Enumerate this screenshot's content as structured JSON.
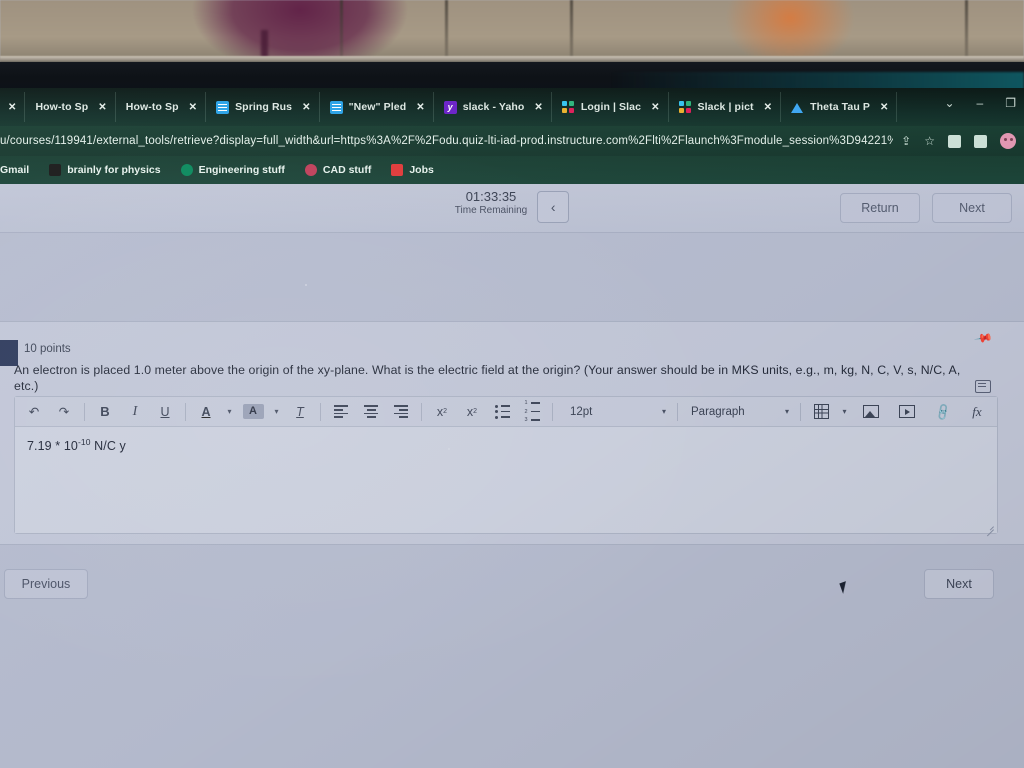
{
  "browser": {
    "tabs": [
      {
        "title": "",
        "favicon": "none",
        "close_label": "✕"
      },
      {
        "title": "How-to Sp",
        "favicon": "none",
        "close_label": "✕"
      },
      {
        "title": "How-to Sp",
        "favicon": "none",
        "close_label": "✕"
      },
      {
        "title": "Spring Rus",
        "favicon": "doc-icon",
        "close_label": "✕"
      },
      {
        "title": "\"New\" Pled",
        "favicon": "doc-icon",
        "close_label": "✕"
      },
      {
        "title": "slack - Yaho",
        "favicon": "yahoo-icon",
        "close_label": "✕"
      },
      {
        "title": "Login | Slac",
        "favicon": "slack-icon",
        "close_label": "✕"
      },
      {
        "title": "Slack | pict",
        "favicon": "slack-icon",
        "close_label": "✕"
      },
      {
        "title": "Theta Tau P",
        "favicon": "drive-icon",
        "close_label": "✕"
      }
    ],
    "new_tab_label": "+",
    "window_controls": {
      "chevron": "⌄",
      "minimize": "–",
      "maximize": "❐"
    },
    "url": "u/courses/119941/external_tools/retrieve?display=full_width&url=https%3A%2F%2Fodu.quiz-lti-iad-prod.instructure.com%2Flti%2Flaunch%3Fmodule_session%3D94221%26as…",
    "url_icons": {
      "share": "⇪",
      "bookmark": "☆",
      "extensions": "puzzle-icon",
      "sidebar": "sidebar-icon",
      "profile": "avatar-icon"
    },
    "bookmarks": [
      {
        "label": "Gmail",
        "icon": "gmail-icon"
      },
      {
        "label": "brainly for physics",
        "icon": "square-icon"
      },
      {
        "label": "Engineering stuff",
        "icon": "globe-icon"
      },
      {
        "label": "CAD stuff",
        "icon": "cad-icon"
      },
      {
        "label": "Jobs",
        "icon": "jobs-icon"
      }
    ]
  },
  "quiz": {
    "timer": {
      "value": "01:33:35",
      "label": "Time Remaining"
    },
    "collapse_icon": "‹",
    "header_buttons": {
      "return": "Return",
      "next": "Next"
    },
    "question": {
      "points": "10 points",
      "text": "An electron is placed 1.0 meter above the origin of the xy-plane.  What is the electric field at the origin? (Your answer should be in MKS units, e.g., m, kg, N, C, V, s, N/C, A, etc.)",
      "pin_icon": "pin-icon",
      "calculator_icon": "calculator-icon"
    },
    "editor": {
      "toolbar": {
        "undo": "↶",
        "redo": "↷",
        "bold": "B",
        "italic": "I",
        "underline": "U",
        "text_color": "A",
        "highlight": "A",
        "clear_format": "T",
        "align_left": "align-left-icon",
        "align_center": "align-center-icon",
        "align_right": "align-right-icon",
        "superscript": "x",
        "superscript_sup": "2",
        "subscript": "x",
        "subscript_sub": "2",
        "bullet_list": "bullet-list-icon",
        "numbered_list": "numbered-list-icon",
        "font_size": "12pt",
        "block_format": "Paragraph",
        "table": "table-icon",
        "image": "image-icon",
        "media": "media-icon",
        "link": "link-icon",
        "equation": "fx",
        "caret": "▾"
      },
      "answer": {
        "prefix": "7.19 * 10",
        "exponent": "-10",
        "suffix": " N/C y"
      }
    },
    "nav": {
      "previous": "Previous",
      "next": "Next"
    }
  }
}
